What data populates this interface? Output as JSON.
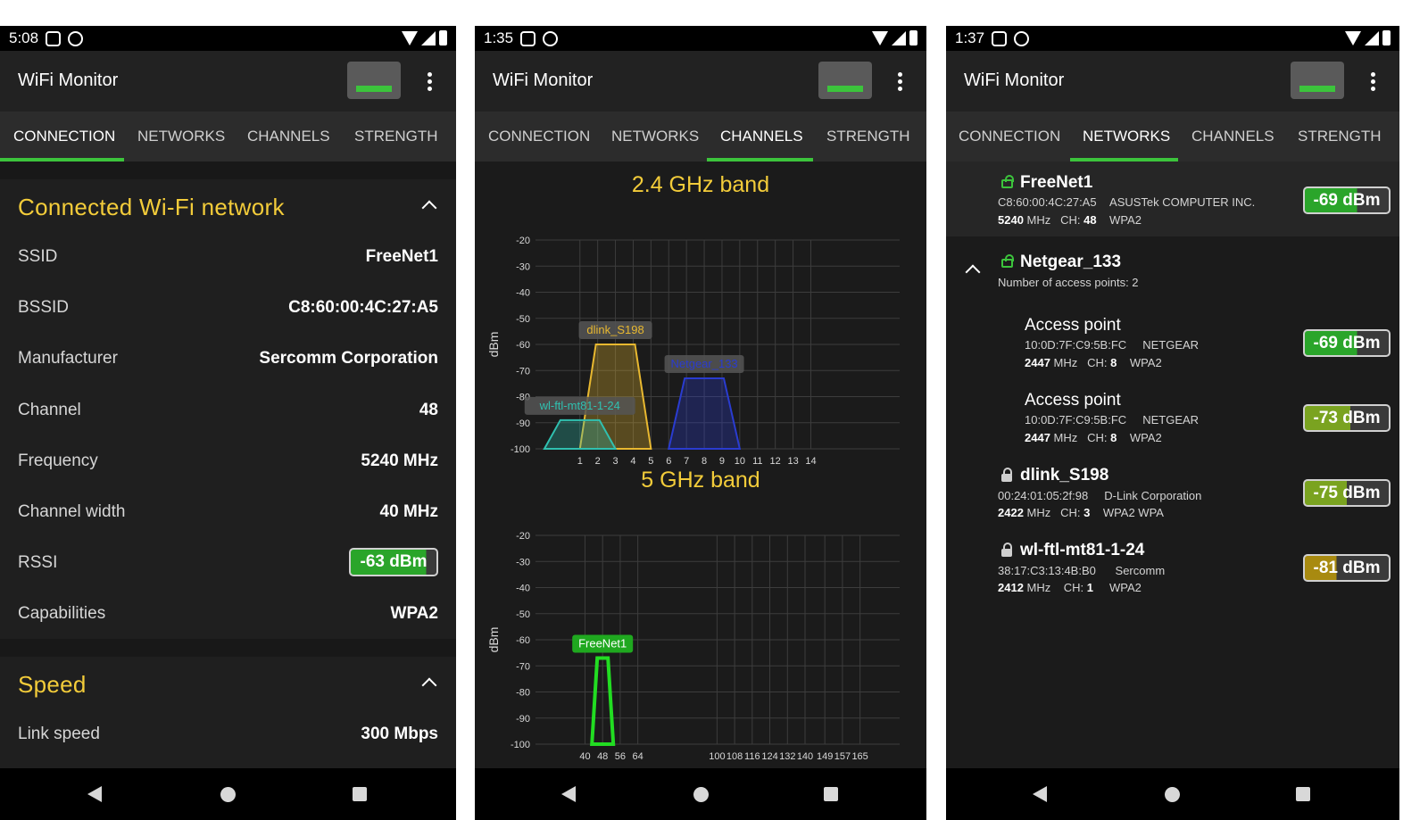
{
  "screens": [
    {
      "status_time": "5:08",
      "app_title": "WiFi Monitor",
      "tabs": [
        "CONNECTION",
        "NETWORKS",
        "CHANNELS",
        "STRENGTH"
      ],
      "active_tab": "CONNECTION",
      "connected_section": {
        "title": "Connected Wi-Fi network",
        "rows": [
          {
            "label": "SSID",
            "value": "FreeNet1"
          },
          {
            "label": "BSSID",
            "value": "C8:60:00:4C:27:A5"
          },
          {
            "label": "Manufacturer",
            "value": "Sercomm Corporation"
          },
          {
            "label": "Channel",
            "value": "48"
          },
          {
            "label": "Frequency",
            "value": "5240 MHz"
          },
          {
            "label": "Channel width",
            "value": "40 MHz"
          },
          {
            "label": "RSSI",
            "value": "-63 dBm"
          },
          {
            "label": "Capabilities",
            "value": "WPA2"
          }
        ]
      },
      "speed_section": {
        "title": "Speed",
        "rows": [
          {
            "label": "Link speed",
            "value": "300 Mbps"
          }
        ]
      }
    },
    {
      "status_time": "1:35",
      "app_title": "WiFi Monitor",
      "tabs": [
        "CONNECTION",
        "NETWORKS",
        "CHANNELS",
        "STRENGTH"
      ],
      "active_tab": "CHANNELS",
      "band24_title": "2.4 GHz band",
      "band5_title": "5 GHz band"
    },
    {
      "status_time": "1:37",
      "app_title": "WiFi Monitor",
      "tabs": [
        "CONNECTION",
        "NETWORKS",
        "CHANNELS",
        "STRENGTH"
      ],
      "active_tab": "NETWORKS",
      "networks": [
        {
          "ssid": "FreeNet1",
          "bssid": "C8:60:00:4C:27:A5",
          "vendor": "ASUSTek COMPUTER INC.",
          "freq": "5240",
          "freq_unit": "MHz",
          "ch_label": "CH:",
          "ch": "48",
          "security": "WPA2",
          "signal": "-69 dBm",
          "level": -69
        },
        {
          "ssid": "Netgear_133",
          "subtitle": "Number of access points: 2"
        },
        {
          "ap_title": "Access point",
          "bssid": "10:0D:7F:C9:5B:FC",
          "vendor": "NETGEAR",
          "freq": "2447",
          "freq_unit": "MHz",
          "ch_label": "CH:",
          "ch": "8",
          "security": "WPA2",
          "signal": "-69 dBm",
          "level": -69
        },
        {
          "ap_title": "Access point",
          "bssid": "10:0D:7F:C9:5B:FC",
          "vendor": "NETGEAR",
          "freq": "2447",
          "freq_unit": "MHz",
          "ch_label": "CH:",
          "ch": "8",
          "security": "WPA2",
          "signal": "-73 dBm",
          "level": -73
        },
        {
          "ssid": "dlink_S198",
          "bssid": "00:24:01:05:2f:98",
          "vendor": "D-Link Corporation",
          "freq": "2422",
          "freq_unit": "MHz",
          "ch_label": "CH:",
          "ch": "3",
          "security": "WPA2 WPA",
          "signal": "-75 dBm",
          "level": -75
        },
        {
          "ssid": "wl-ftl-mt81-1-24",
          "bssid": "38:17:C3:13:4B:B0",
          "vendor": "Sercomm",
          "freq": "2412",
          "freq_unit": "MHz",
          "ch_label": "CH:",
          "ch": "1",
          "security": "WPA2",
          "signal": "-81 dBm",
          "level": -81
        }
      ]
    }
  ],
  "colors": {
    "accent_green": "#3cc43c",
    "title_yellow": "#f3cc3a",
    "dlink": "#e8b830",
    "netgear": "#2a3cd0",
    "wlftl": "#30c0b0",
    "freenet": "#22dd22"
  },
  "chart_data": [
    {
      "type": "area",
      "title": "2.4 GHz band",
      "ylabel": "dBm",
      "ylim": [
        -100,
        -20
      ],
      "y_ticks": [
        "-20",
        "-30",
        "-40",
        "-50",
        "-60",
        "-70",
        "-80",
        "-90",
        "-100"
      ],
      "x_ticks": [
        "1",
        "2",
        "3",
        "4",
        "5",
        "6",
        "7",
        "8",
        "9",
        "10",
        "11",
        "12",
        "13",
        "14"
      ],
      "x_tick_values": [
        1,
        2,
        3,
        4,
        5,
        6,
        7,
        8,
        9,
        10,
        11,
        12,
        13,
        14
      ],
      "xlim": [
        -1.5,
        19
      ],
      "series": [
        {
          "name": "dlink_S198",
          "center": 3,
          "level": -60,
          "color": "#e8b830"
        },
        {
          "name": "Netgear_133",
          "center": 8,
          "level": -73,
          "color": "#2a3cd0"
        },
        {
          "name": "wl-ftl-mt81-1-24",
          "center": 1,
          "level": -89,
          "color": "#30c0b0"
        }
      ]
    },
    {
      "type": "area",
      "title": "5 GHz band",
      "ylabel": "dBm",
      "ylim": [
        -100,
        -20
      ],
      "y_ticks": [
        "-20",
        "-30",
        "-40",
        "-50",
        "-60",
        "-70",
        "-80",
        "-90",
        "-100"
      ],
      "x_ticks": [
        "40",
        "48",
        "56",
        "64",
        "100",
        "108",
        "116",
        "124",
        "132",
        "140",
        "149",
        "157",
        "165"
      ],
      "x_tick_positions": [
        40,
        48,
        56,
        64,
        100,
        108,
        116,
        124,
        132,
        140,
        149,
        157,
        165
      ],
      "xlim": [
        17.5,
        183
      ],
      "series": [
        {
          "name": "FreeNet1",
          "center": 48,
          "level": -67,
          "color": "#22dd22"
        }
      ]
    }
  ]
}
